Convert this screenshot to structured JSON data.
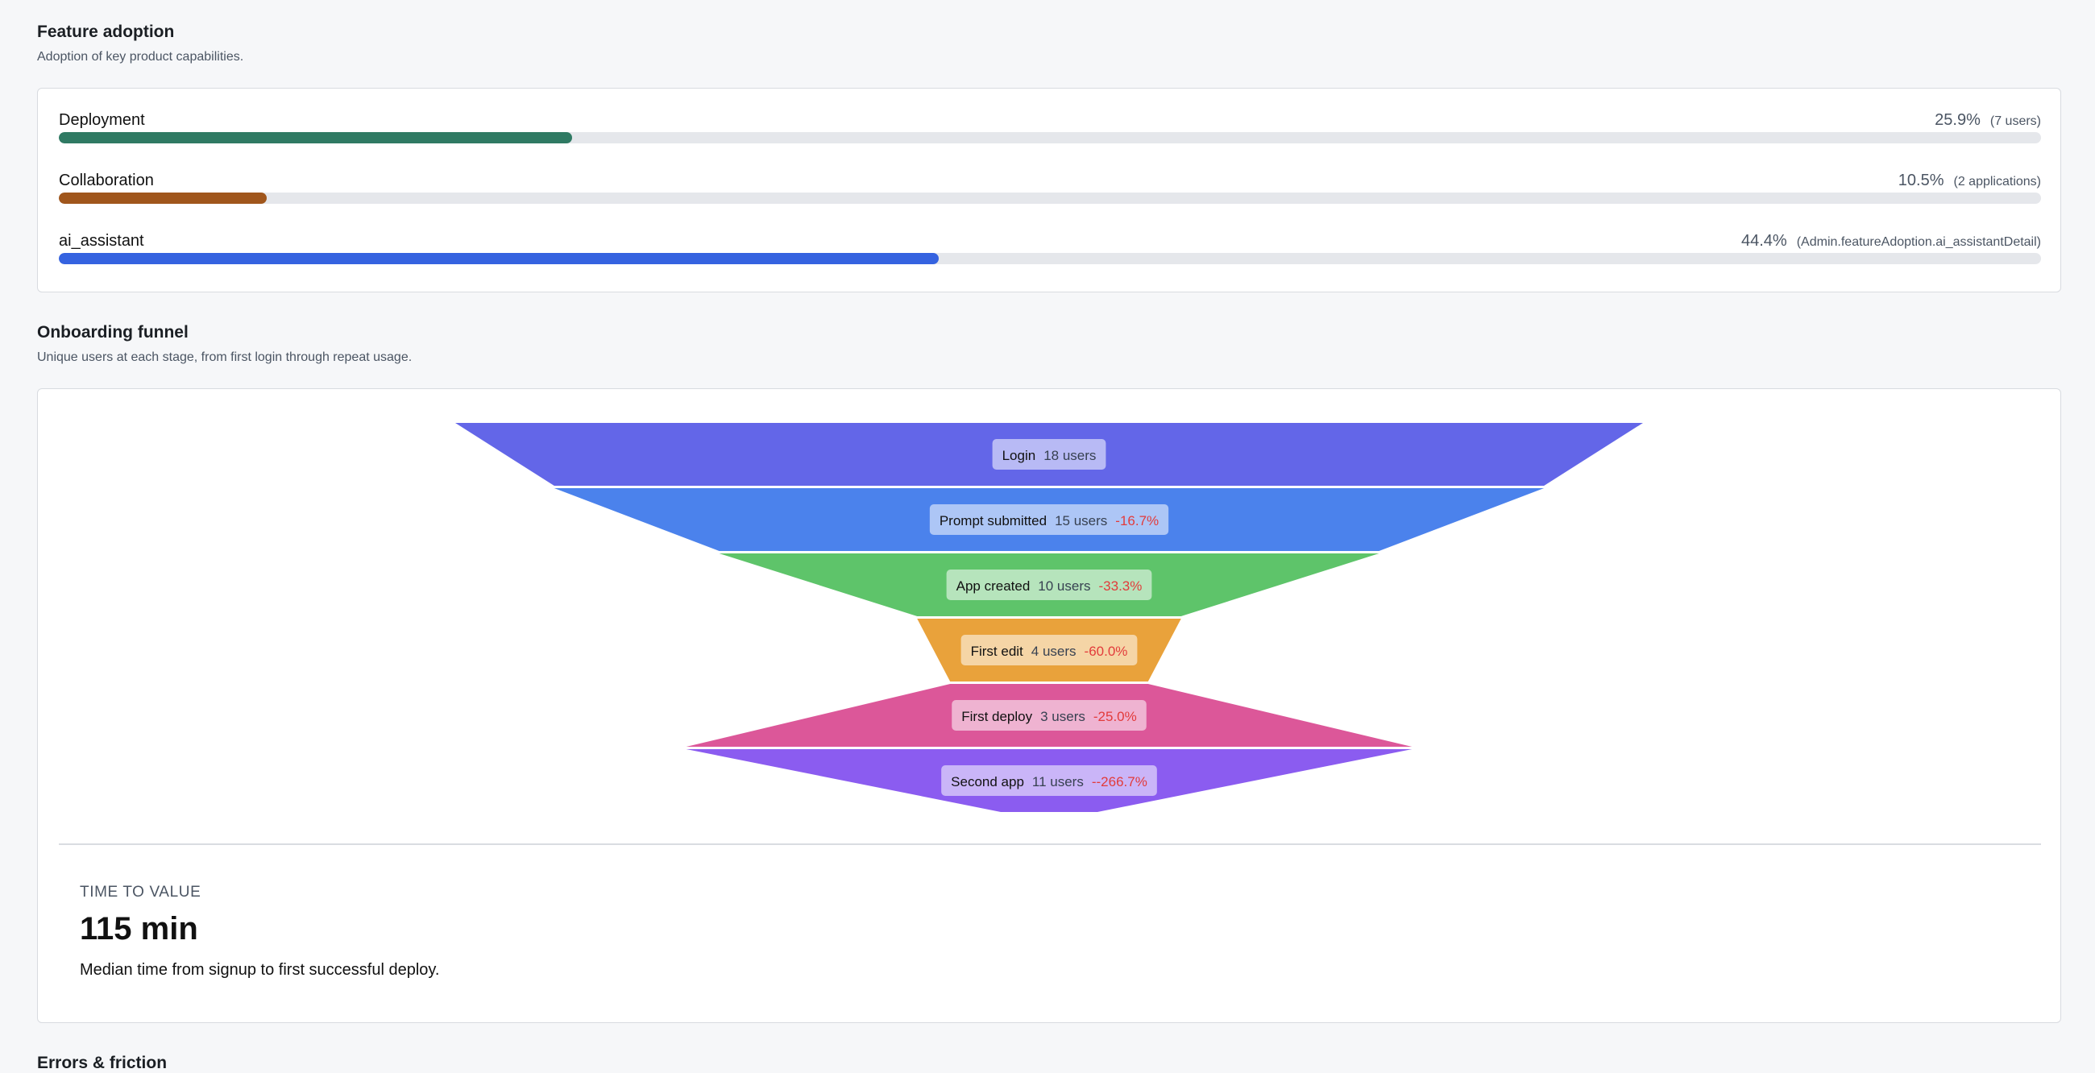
{
  "feature_adoption": {
    "title": "Feature adoption",
    "subtitle": "Adoption of key product capabilities.",
    "items": [
      {
        "name": "Deployment",
        "percent_label": "25.9%",
        "detail": "(7 users)",
        "fraction": 0.259,
        "color": "#2f7a63"
      },
      {
        "name": "Collaboration",
        "percent_label": "10.5%",
        "detail": "(2 applications)",
        "fraction": 0.105,
        "color": "#a0561c"
      },
      {
        "name": "ai_assistant",
        "percent_label": "44.4%",
        "detail": "(Admin.featureAdoption.ai_assistantDetail)",
        "fraction": 0.444,
        "color": "#3563e0"
      }
    ]
  },
  "onboarding_funnel": {
    "title": "Onboarding funnel",
    "subtitle": "Unique users at each stage, from first login through repeat usage.",
    "stages": [
      {
        "name": "Login",
        "users": 18,
        "users_label": "18 users",
        "change": "",
        "color": "#6366e8"
      },
      {
        "name": "Prompt submitted",
        "users": 15,
        "users_label": "15 users",
        "change": "-16.7%",
        "color": "#4b82ec"
      },
      {
        "name": "App created",
        "users": 10,
        "users_label": "10 users",
        "change": "-33.3%",
        "color": "#5ec46a"
      },
      {
        "name": "First edit",
        "users": 4,
        "users_label": "4 users",
        "change": "-60.0%",
        "color": "#e9a23b"
      },
      {
        "name": "First deploy",
        "users": 3,
        "users_label": "3 users",
        "change": "-25.0%",
        "color": "#dc5799"
      },
      {
        "name": "Second app",
        "users": 11,
        "users_label": "11 users",
        "change": "--266.7%",
        "color": "#8b5cf0"
      }
    ],
    "change_color": "#e23b3b",
    "time_to_value": {
      "label": "TIME TO VALUE",
      "value": "115 min",
      "description": "Median time from signup to first successful deploy."
    }
  },
  "errors_friction": {
    "title": "Errors & friction"
  }
}
